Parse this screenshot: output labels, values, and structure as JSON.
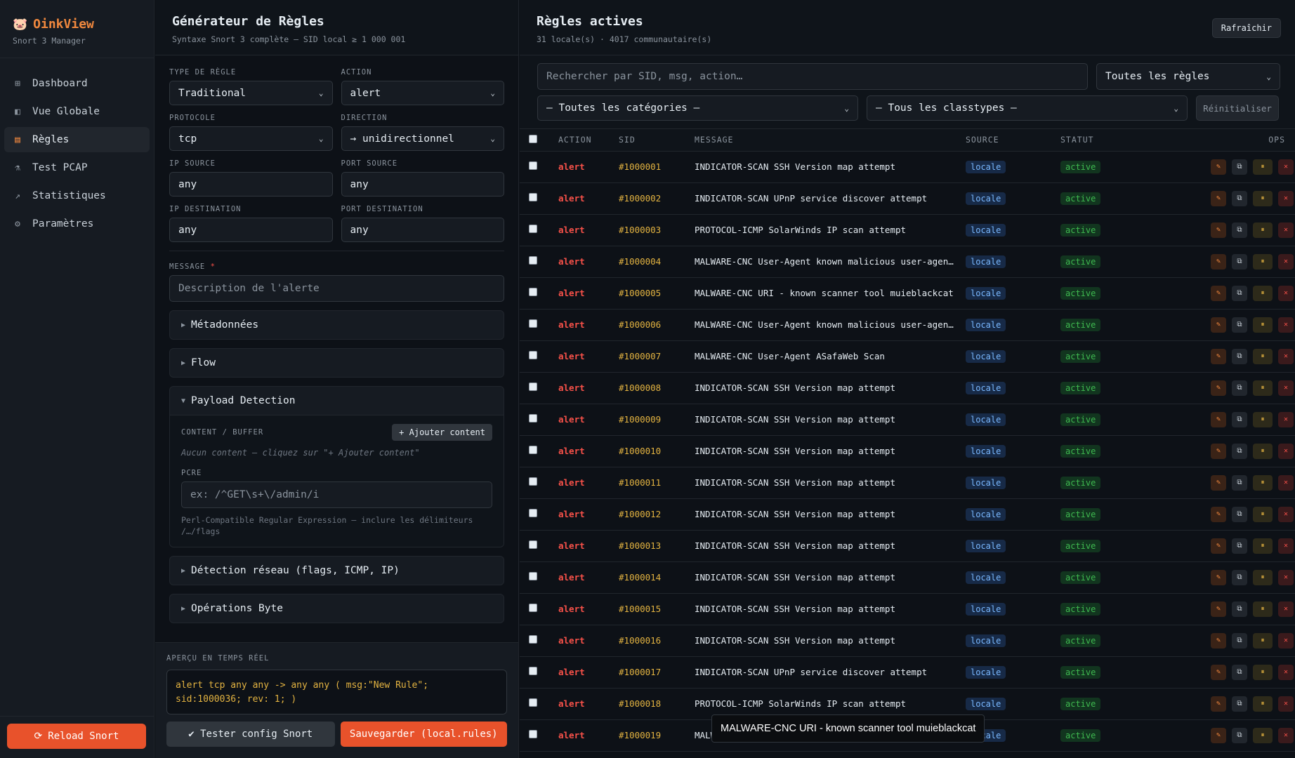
{
  "app": {
    "name": "OinkView",
    "subtitle": "Snort 3 Manager",
    "logo": "🐷"
  },
  "sidebar": {
    "items": [
      {
        "icon": "dashboard-icon",
        "glyph": "⊞",
        "label": "Dashboard",
        "active": false
      },
      {
        "icon": "overview-icon",
        "glyph": "◧",
        "label": "Vue Globale",
        "active": false
      },
      {
        "icon": "clipboard-icon",
        "glyph": "▤",
        "label": "Règles",
        "active": true
      },
      {
        "icon": "flask-icon",
        "glyph": "⚗",
        "label": "Test PCAP",
        "active": false
      },
      {
        "icon": "trend-icon",
        "glyph": "↗",
        "label": "Statistiques",
        "active": false
      },
      {
        "icon": "gear-icon",
        "glyph": "⚙",
        "label": "Paramètres",
        "active": false
      }
    ],
    "reload_label": "Reload Snort"
  },
  "generator": {
    "title": "Générateur de Règles",
    "subtitle": "Syntaxe Snort 3 complète — SID local ≥ 1 000 001",
    "rule_type": {
      "label": "TYPE DE RÈGLE",
      "value": "Traditional"
    },
    "action": {
      "label": "ACTION",
      "value": "alert"
    },
    "protocol": {
      "label": "PROTOCOLE",
      "value": "tcp"
    },
    "direction": {
      "label": "DIRECTION",
      "value": "→ unidirectionnel"
    },
    "src_ip": {
      "label": "IP SOURCE",
      "value": "any"
    },
    "src_port": {
      "label": "PORT SOURCE",
      "value": "any"
    },
    "dst_ip": {
      "label": "IP DESTINATION",
      "value": "any"
    },
    "dst_port": {
      "label": "PORT DESTINATION",
      "value": "any"
    },
    "message": {
      "label": "MESSAGE",
      "required_mark": "*",
      "placeholder": "Description de l'alerte"
    },
    "sections": {
      "metadata": "Métadonnées",
      "flow": "Flow",
      "payload": "Payload Detection",
      "network": "Détection réseau (flags, ICMP, IP)",
      "byte_ops": "Opérations Byte"
    },
    "payload": {
      "content_label": "CONTENT / BUFFER",
      "add_content_label": "+ Ajouter content",
      "empty_hint": "Aucun content — cliquez sur \"+ Ajouter content\"",
      "pcre_label": "PCRE",
      "pcre_placeholder": "ex: /^GET\\s+\\/admin/i",
      "pcre_hint": "Perl-Compatible Regular Expression — inclure les délimiteurs /…/flags"
    },
    "preview": {
      "label": "APERÇU EN TEMPS RÉEL",
      "code": "alert tcp any any -> any any ( msg:\"New Rule\"; sid:1000036; rev: 1; )",
      "test_label": "✔ Tester config Snort",
      "save_label": "Sauvegarder (local.rules)"
    }
  },
  "rules": {
    "title": "Règles actives",
    "subtitle": "31 locale(s) · 4017 communautaire(s)",
    "refresh_label": "Rafraîchir",
    "search_placeholder": "Rechercher par SID, msg, action…",
    "filter_all": "Toutes les règles",
    "filter_categories": "— Toutes les catégories —",
    "filter_classtypes": "— Tous les classtypes —",
    "reset_label": "Réinitialiser",
    "columns": [
      "ACTION",
      "SID",
      "MESSAGE",
      "SOURCE",
      "STATUT",
      "OPS"
    ],
    "rows": [
      {
        "action": "alert",
        "sid": "#1000001",
        "msg": "INDICATOR-SCAN SSH Version map attempt",
        "source": "locale",
        "status": "active"
      },
      {
        "action": "alert",
        "sid": "#1000002",
        "msg": "INDICATOR-SCAN UPnP service discover attempt",
        "source": "locale",
        "status": "active"
      },
      {
        "action": "alert",
        "sid": "#1000003",
        "msg": "PROTOCOL-ICMP SolarWinds IP scan attempt",
        "source": "locale",
        "status": "active"
      },
      {
        "action": "alert",
        "sid": "#1000004",
        "msg": "MALWARE-CNC User-Agent known malicious user-agen…",
        "source": "locale",
        "status": "active"
      },
      {
        "action": "alert",
        "sid": "#1000005",
        "msg": "MALWARE-CNC URI - known scanner tool muieblackcat",
        "source": "locale",
        "status": "active"
      },
      {
        "action": "alert",
        "sid": "#1000006",
        "msg": "MALWARE-CNC User-Agent known malicious user-agen…",
        "source": "locale",
        "status": "active"
      },
      {
        "action": "alert",
        "sid": "#1000007",
        "msg": "MALWARE-CNC User-Agent ASafaWeb Scan",
        "source": "locale",
        "status": "active"
      },
      {
        "action": "alert",
        "sid": "#1000008",
        "msg": "INDICATOR-SCAN SSH Version map attempt",
        "source": "locale",
        "status": "active"
      },
      {
        "action": "alert",
        "sid": "#1000009",
        "msg": "INDICATOR-SCAN SSH Version map attempt",
        "source": "locale",
        "status": "active"
      },
      {
        "action": "alert",
        "sid": "#1000010",
        "msg": "INDICATOR-SCAN SSH Version map attempt",
        "source": "locale",
        "status": "active"
      },
      {
        "action": "alert",
        "sid": "#1000011",
        "msg": "INDICATOR-SCAN SSH Version map attempt",
        "source": "locale",
        "status": "active"
      },
      {
        "action": "alert",
        "sid": "#1000012",
        "msg": "INDICATOR-SCAN SSH Version map attempt",
        "source": "locale",
        "status": "active"
      },
      {
        "action": "alert",
        "sid": "#1000013",
        "msg": "INDICATOR-SCAN SSH Version map attempt",
        "source": "locale",
        "status": "active"
      },
      {
        "action": "alert",
        "sid": "#1000014",
        "msg": "INDICATOR-SCAN SSH Version map attempt",
        "source": "locale",
        "status": "active"
      },
      {
        "action": "alert",
        "sid": "#1000015",
        "msg": "INDICATOR-SCAN SSH Version map attempt",
        "source": "locale",
        "status": "active"
      },
      {
        "action": "alert",
        "sid": "#1000016",
        "msg": "INDICATOR-SCAN SSH Version map attempt",
        "source": "locale",
        "status": "active"
      },
      {
        "action": "alert",
        "sid": "#1000017",
        "msg": "INDICATOR-SCAN UPnP service discover attempt",
        "source": "locale",
        "status": "active"
      },
      {
        "action": "alert",
        "sid": "#1000018",
        "msg": "PROTOCOL-ICMP SolarWinds IP scan attempt",
        "source": "locale",
        "status": "active"
      },
      {
        "action": "alert",
        "sid": "#1000019",
        "msg": "MALWARE-CNC User-Agent known malicious user-agen…",
        "source": "locale",
        "status": "active"
      }
    ],
    "ops_icons": {
      "edit": "✎",
      "duplicate": "⧉",
      "pause": "⏸",
      "delete": "✕"
    }
  },
  "tooltip": "MALWARE-CNC URI - known scanner tool muieblackcat",
  "colors": {
    "accent": "#f0883e",
    "danger": "#f85149",
    "sid": "#e3b341",
    "ok": "#3fb950",
    "bg": "#0d1117"
  }
}
